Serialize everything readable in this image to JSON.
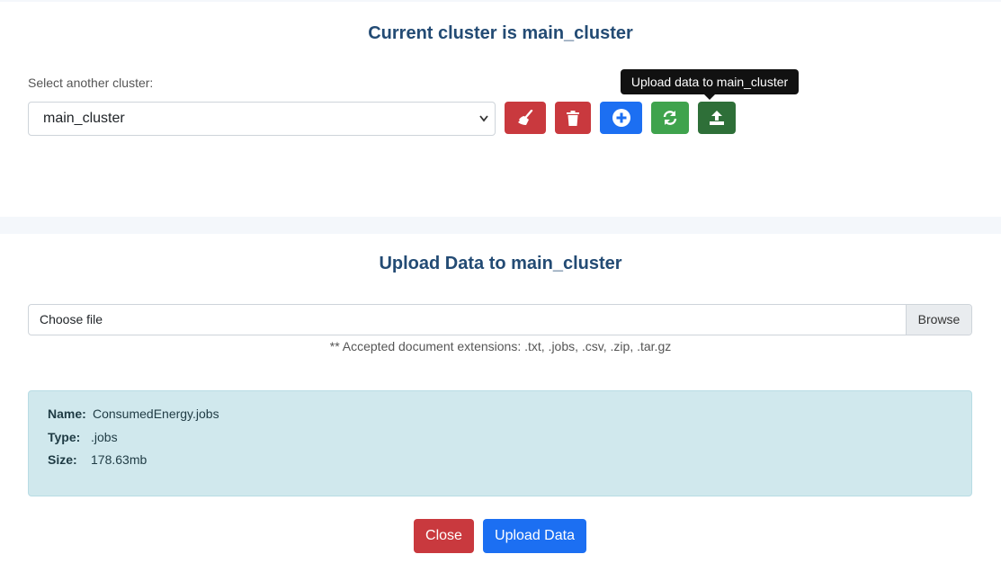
{
  "cluster_panel": {
    "title": "Current cluster is main_cluster",
    "select_label": "Select another cluster:",
    "selected_cluster": "main_cluster",
    "tooltip": "Upload data to main_cluster",
    "buttons": [
      {
        "name": "clear-button",
        "icon": "broom-icon",
        "color": "#c9393e"
      },
      {
        "name": "delete-button",
        "icon": "trash-icon",
        "color": "#c9393e"
      },
      {
        "name": "add-button",
        "icon": "plus-circle-icon",
        "color": "#1c6ff2"
      },
      {
        "name": "refresh-button",
        "icon": "refresh-icon",
        "color": "#3fa34d"
      },
      {
        "name": "upload-button",
        "icon": "upload-icon",
        "color": "#2e6f38"
      }
    ]
  },
  "upload_panel": {
    "title": "Upload Data to main_cluster",
    "file_placeholder": "Choose file",
    "browse_label": "Browse",
    "hint": "** Accepted document extensions: .txt, .jobs, .csv, .zip, .tar.gz",
    "file_info": {
      "name_label": "Name:",
      "name_value": "ConsumedEnergy.jobs",
      "type_label": "Type:",
      "type_value": ".jobs",
      "size_label": "Size:",
      "size_value": "178.63mb"
    },
    "close_label": "Close",
    "upload_label": "Upload Data"
  }
}
